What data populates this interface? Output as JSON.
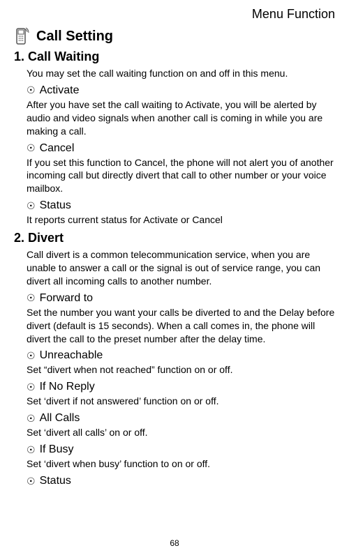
{
  "header": "Menu Function",
  "sectionTitle": "Call Setting",
  "page": "68",
  "sections": [
    {
      "heading": "1. Call Waiting",
      "intro": "You may set the call waiting function on and off in this menu.",
      "items": [
        {
          "title": "Activate",
          "body": "After you have set the call waiting to Activate, you will be alerted by audio and video signals when another call is coming in while you are making a call."
        },
        {
          "title": "Cancel",
          "body": "If you set this function to Cancel, the phone will not alert you of another incoming call but directly divert that call to other number or your voice mailbox."
        },
        {
          "title": "Status",
          "body": "It reports current status for Activate or Cancel"
        }
      ]
    },
    {
      "heading": "2. Divert",
      "intro": "Call divert is a common telecommunication service, when you are unable to answer a call or the signal is out of service range, you can divert all incoming calls to another number.",
      "items": [
        {
          "title": "Forward to",
          "body": "Set the number you want your calls be diverted to and the Delay before divert (default is 15 seconds). When a call comes in, the phone will divert the call to the preset number after the delay time."
        },
        {
          "title": "Unreachable",
          "body": "Set “divert when not reached” function on or off."
        },
        {
          "title": "If No Reply",
          "body": "Set ‘divert if not answered’ function on or off."
        },
        {
          "title": "All Calls",
          "body": "Set ‘divert all calls’ on or off."
        },
        {
          "title": "If Busy",
          "body": "Set ‘divert when busy’ function to on or off."
        },
        {
          "title": "Status",
          "body": ""
        }
      ]
    }
  ]
}
